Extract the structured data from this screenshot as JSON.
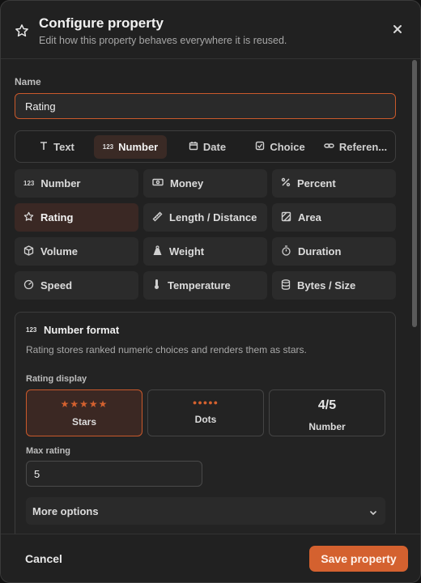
{
  "header": {
    "title": "Configure property",
    "subtitle": "Edit how this property behaves everywhere it is reused."
  },
  "name_field": {
    "label": "Name",
    "value": "Rating"
  },
  "type_tabs": [
    {
      "label": "Text",
      "icon": "text-icon"
    },
    {
      "label": "Number",
      "icon": "number-icon",
      "active": true
    },
    {
      "label": "Date",
      "icon": "calendar-icon"
    },
    {
      "label": "Choice",
      "icon": "checkbox-icon"
    },
    {
      "label": "Referen...",
      "icon": "link-icon"
    }
  ],
  "number_subtypes": [
    {
      "label": "Number",
      "icon": "number-icon"
    },
    {
      "label": "Money",
      "icon": "money-icon"
    },
    {
      "label": "Percent",
      "icon": "percent-icon"
    },
    {
      "label": "Rating",
      "icon": "star-icon",
      "active": true
    },
    {
      "label": "Length / Distance",
      "icon": "ruler-icon"
    },
    {
      "label": "Area",
      "icon": "area-icon"
    },
    {
      "label": "Volume",
      "icon": "cube-icon"
    },
    {
      "label": "Weight",
      "icon": "weight-icon"
    },
    {
      "label": "Duration",
      "icon": "stopwatch-icon"
    },
    {
      "label": "Speed",
      "icon": "gauge-icon"
    },
    {
      "label": "Temperature",
      "icon": "thermometer-icon"
    },
    {
      "label": "Bytes / Size",
      "icon": "database-icon"
    }
  ],
  "format_panel": {
    "title": "Number format",
    "description": "Rating stores ranked numeric choices and renders them as stars.",
    "display_label": "Rating display",
    "display_options": [
      {
        "label": "Stars",
        "preview": "★★★★★",
        "active": true
      },
      {
        "label": "Dots",
        "preview": "●●●●●"
      },
      {
        "label": "Number",
        "preview": "4/5"
      }
    ],
    "max_rating_label": "Max rating",
    "max_rating_value": "5",
    "more_options_label": "More options"
  },
  "footer": {
    "cancel_label": "Cancel",
    "save_label": "Save property"
  },
  "colors": {
    "accent": "#d4612f",
    "active_bg": "#3a2824",
    "panel_bg": "#212121"
  }
}
